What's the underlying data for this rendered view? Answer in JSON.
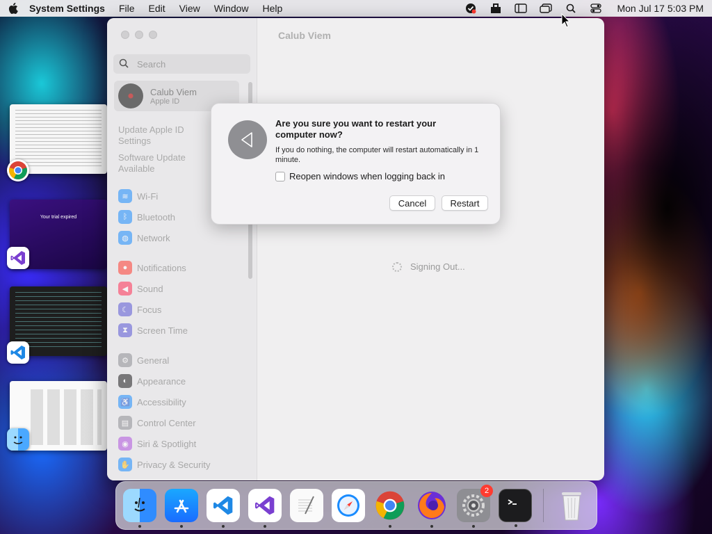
{
  "menubar": {
    "app_name": "System Settings",
    "menus": [
      "File",
      "Edit",
      "View",
      "Window",
      "Help"
    ],
    "status_icons": [
      "norton-icon",
      "briefcase-icon",
      "sidebar-icon",
      "windows-icon",
      "search-icon",
      "control-center-icon"
    ],
    "clock": "Mon Jul 17  5:03 PM"
  },
  "stage_manager": {
    "trial_text": "Your trial expired"
  },
  "settings": {
    "search_placeholder": "Search",
    "profile": {
      "name": "Calub Viem",
      "subtitle": "Apple ID"
    },
    "notes": [
      "Update Apple ID Settings",
      "Software Update Available"
    ],
    "items": [
      {
        "label": "Wi-Fi",
        "color": "#1a8cff"
      },
      {
        "label": "Bluetooth",
        "color": "#1a8cff"
      },
      {
        "label": "Network",
        "color": "#1a8cff"
      },
      {
        "label": "Notifications",
        "color": "#ff3b30"
      },
      {
        "label": "Sound",
        "color": "#ff2d55"
      },
      {
        "label": "Focus",
        "color": "#5856d6"
      },
      {
        "label": "Screen Time",
        "color": "#5856d6"
      },
      {
        "label": "General",
        "color": "#8e8e93"
      },
      {
        "label": "Appearance",
        "color": "#1c1c1e"
      },
      {
        "label": "Accessibility",
        "color": "#1a8cff"
      },
      {
        "label": "Control Center",
        "color": "#8e8e93"
      },
      {
        "label": "Siri & Spotlight",
        "color": "#af52de"
      },
      {
        "label": "Privacy & Security",
        "color": "#1a8cff"
      }
    ],
    "content_title": "Calub Viem",
    "status_text": "Signing Out..."
  },
  "dialog": {
    "title": "Are you sure you want to restart your computer now?",
    "message": "If you do nothing, the computer will restart automatically in 1 minute.",
    "checkbox_label": "Reopen windows when logging back in",
    "cancel": "Cancel",
    "confirm": "Restart"
  },
  "dock": {
    "apps": [
      "Finder",
      "App Store",
      "Visual Studio Code",
      "Visual Studio",
      "TextEdit",
      "Safari",
      "Google Chrome",
      "Firefox",
      "System Settings",
      "Terminal"
    ],
    "settings_badge": "2",
    "trash": "Trash"
  }
}
